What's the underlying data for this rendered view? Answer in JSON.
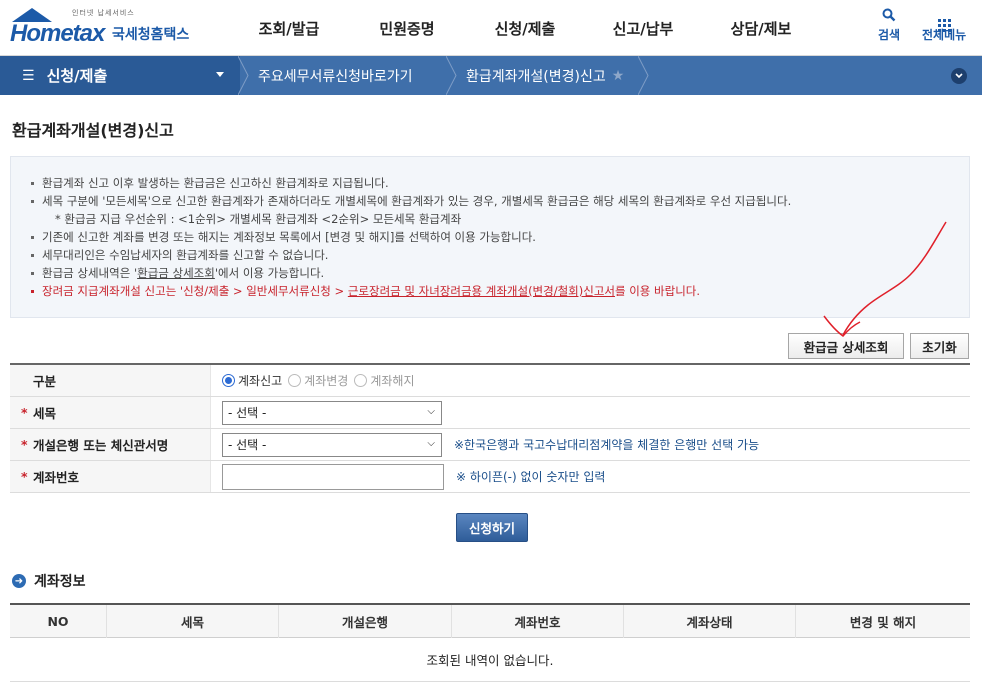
{
  "header": {
    "logo_small": "인터넷 납세서비스",
    "logo_main": "Hometax",
    "logo_kr": "국세청홈택스",
    "nav": [
      "조회/발급",
      "민원증명",
      "신청/제출",
      "신고/납부",
      "상담/제보"
    ],
    "search_label": "검색",
    "menu_label": "전체메뉴"
  },
  "breadcrumb": {
    "menu": "신청/제출",
    "item1": "주요세무서류신청바로가기",
    "item2": "환급계좌개설(변경)신고"
  },
  "page": {
    "title": "환급계좌개설(변경)신고"
  },
  "info": {
    "line1": "환급계좌 신고 이후 발생하는 환급금은 신고하신 환급계좌로 지급됩니다.",
    "line2": "세목 구분에 '모든세목'으로 신고한 환급계좌가 존재하더라도 개별세목에 환급계좌가 있는 경우, 개별세목 환급금은 해당 세목의 환급계좌로 우선 지급됩니다.",
    "line3": "* 환급금 지급 우선순위 : <1순위> 개별세목 환급계좌  <2순위> 모든세목 환급계좌",
    "line4": "기존에 신고한 계좌를 변경 또는 해지는 계좌정보 목록에서 [변경 및 해지]를 선택하여 이용 가능합니다.",
    "line5": "세무대리인은 수임납세자의 환급계좌를 신고할 수 없습니다.",
    "line6_pre": "환급금 상세내역은 '",
    "line6_link": "환급금 상세조회",
    "line6_post": "'에서 이용 가능합니다.",
    "line7_pre": "장려금 지급계좌개설 신고는 '신청/제출 > 일반세무서류신청 > ",
    "line7_link": "근로장려금 및 자녀장려금용 계좌개설(변경/철회)신고서",
    "line7_post": "를 이용 바랍니다."
  },
  "buttons": {
    "refund_detail": "환급금 상세조회",
    "reset": "초기화",
    "submit": "신청하기"
  },
  "form": {
    "type_label": "구분",
    "radio1": "계좌신고",
    "radio2": "계좌변경",
    "radio3": "계좌해지",
    "tax_label": "세목",
    "tax_value": "- 선택 -",
    "bank_label": "개설은행 또는 체신관서명",
    "bank_value": "- 선택 -",
    "bank_note": "※한국은행과 국고수납대리점계약을 체결한 은행만 선택 가능",
    "account_label": "계좌번호",
    "account_value": "",
    "account_note": "※ 하이픈(-) 없이 숫자만 입력",
    "required_mark": "*"
  },
  "account_section": {
    "title": "계좌정보",
    "columns": [
      "NO",
      "세목",
      "개설은행",
      "계좌번호",
      "계좌상태",
      "변경 및 해지"
    ],
    "empty": "조회된 내역이 없습니다."
  },
  "colors": {
    "brand": "#1c5aa8",
    "crumb_bar": "#3f6faa",
    "required": "#c8232c",
    "annotation": "#e0202a"
  },
  "icons": {
    "search": "search-icon",
    "menu": "grid-menu-icon",
    "favorite": "star-icon",
    "dropdown": "chevron-down-icon",
    "section": "arrow-circle-icon"
  }
}
